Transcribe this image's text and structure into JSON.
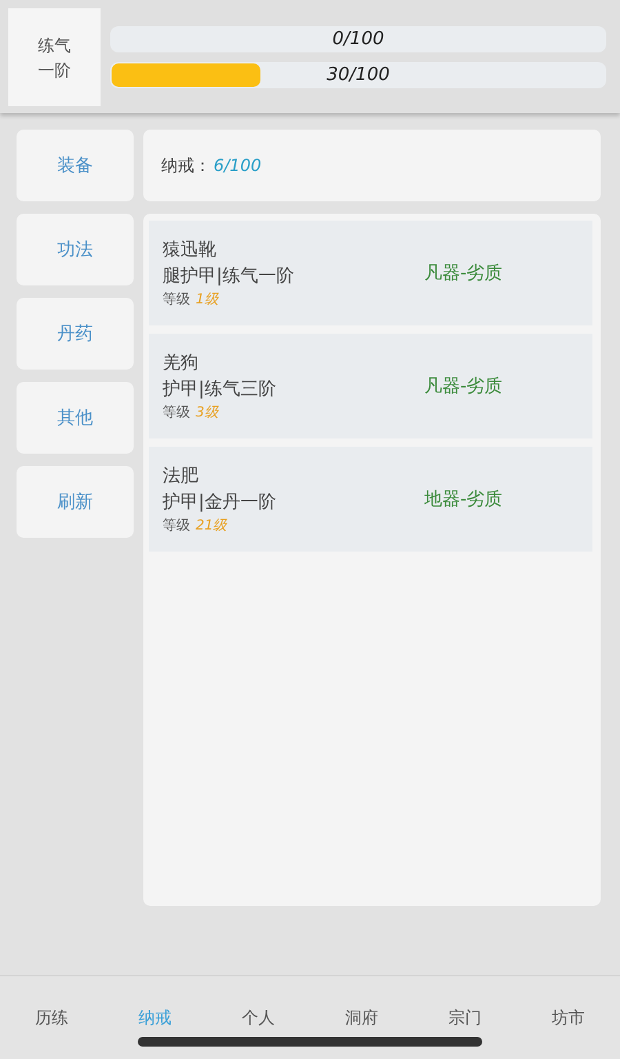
{
  "header": {
    "realm": [
      "练气",
      "一阶"
    ],
    "bars": [
      {
        "label": "0/100"
      },
      {
        "label": "30/100",
        "level": 0.3
      }
    ]
  },
  "sidebar": {
    "items": [
      "装备",
      "功法",
      "丹药",
      "其他",
      "刷新"
    ]
  },
  "capacity": {
    "label": "纳戒：",
    "value": "6/100"
  },
  "items": [
    {
      "name": "猿迅靴",
      "type": "腿护甲|练气一阶",
      "level_label": "等级",
      "level": "1级",
      "grade": "凡器-劣质"
    },
    {
      "name": "羌狗",
      "type": "护甲|练气三阶",
      "level_label": "等级",
      "level": "3级",
      "grade": "凡器-劣质"
    },
    {
      "name": "法肥",
      "type": "护甲|金丹一阶",
      "level_label": "等级",
      "level": "21级",
      "grade": "地器-劣质"
    }
  ],
  "tabs": [
    {
      "label": "历练",
      "selected": false
    },
    {
      "label": "纳戒",
      "selected": true
    },
    {
      "label": "个人",
      "selected": false
    },
    {
      "label": "洞府",
      "selected": false
    },
    {
      "label": "宗门",
      "selected": false
    },
    {
      "label": "坊市",
      "selected": false
    }
  ]
}
